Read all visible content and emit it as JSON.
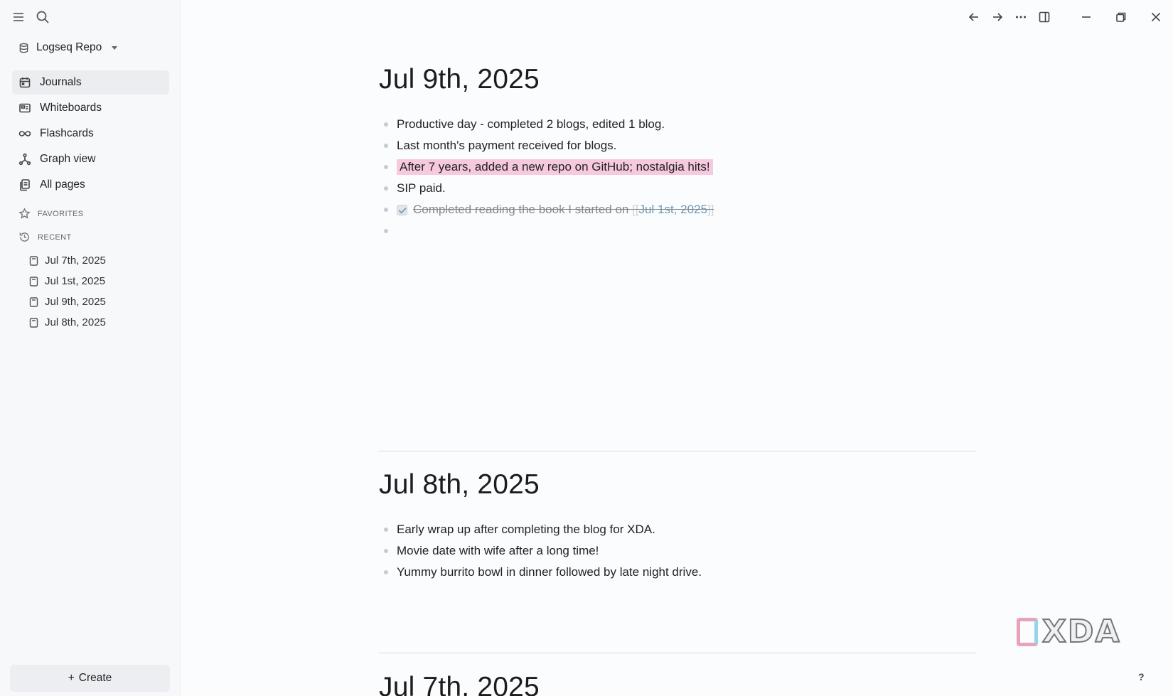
{
  "sidebar": {
    "repo_name": "Logseq Repo",
    "nav": [
      {
        "label": "Journals",
        "icon": "calendar-icon",
        "active": true
      },
      {
        "label": "Whiteboards",
        "icon": "whiteboard-icon"
      },
      {
        "label": "Flashcards",
        "icon": "infinity-icon"
      },
      {
        "label": "Graph view",
        "icon": "graph-icon"
      },
      {
        "label": "All pages",
        "icon": "pages-icon"
      }
    ],
    "favorites_label": "FAVORITES",
    "recent_label": "RECENT",
    "recent": [
      "Jul 7th, 2025",
      "Jul 1st, 2025",
      "Jul 9th, 2025",
      "Jul 8th, 2025"
    ],
    "create_label": "Create",
    "create_plus": "+"
  },
  "journals": [
    {
      "title": "Jul 9th, 2025",
      "blocks": [
        "Productive day - completed 2 blogs, edited 1 blog.",
        "Last month's payment received for blogs.",
        "After 7 years, added a new repo on GitHub; nostalgia hits!",
        "SIP paid."
      ],
      "task_text": "Completed reading the book I started on ",
      "task_ref": "Jul 1st, 2025",
      "bracket_open": "[[",
      "bracket_close": "]]"
    },
    {
      "title": "Jul 8th, 2025",
      "blocks": [
        "Early wrap up after completing the blog for XDA.",
        "Movie date with wife after a long time!",
        "Yummy burrito bowl in dinner followed by late night drive."
      ]
    },
    {
      "title": "Jul 7th, 2025"
    }
  ],
  "watermark": "XDA",
  "help": "?",
  "colors": {
    "highlight": "#f6c9de",
    "page_ref": "#6a9ab5"
  }
}
